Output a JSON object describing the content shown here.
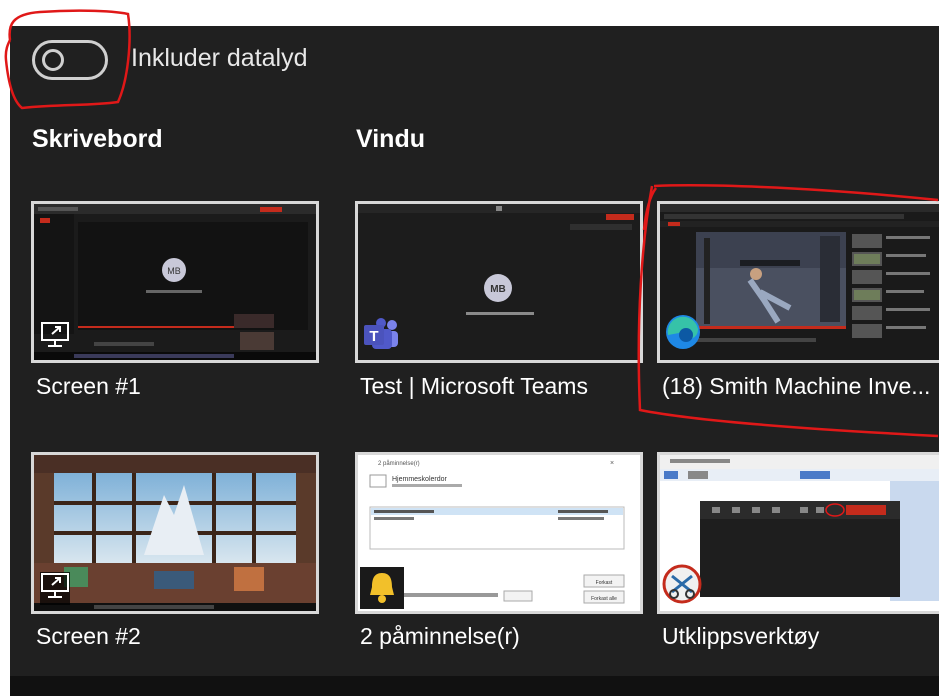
{
  "toggle": {
    "label": "Inkluder datalyd",
    "state": "off"
  },
  "sections": {
    "desktop": "Skrivebord",
    "window": "Vindu"
  },
  "thumbnails": {
    "screen1": {
      "label": "Screen #1",
      "avatar": "MB",
      "icon": "monitor-share-icon"
    },
    "teams": {
      "label": "Test | Microsoft Teams",
      "avatar": "MB",
      "icon": "teams-icon"
    },
    "smith": {
      "label": "(18) Smith Machine Inve...",
      "icon": "edge-icon"
    },
    "screen2": {
      "label": "Screen #2",
      "icon": "monitor-share-icon"
    },
    "reminder": {
      "label": "2 påminnelse(r)",
      "icon": "bell-icon",
      "title": "2 påminnelse(r)",
      "item_title": "Hjemmeskolerdor",
      "btn_dismiss": "Forkast",
      "btn_snooze": "Forkast alle"
    },
    "snip": {
      "label": "Utklippsverktøy",
      "icon": "snipping-tool-icon"
    }
  },
  "colors": {
    "background": "#202020",
    "annotation": "#e01818",
    "accent_red": "#c42b1c"
  }
}
